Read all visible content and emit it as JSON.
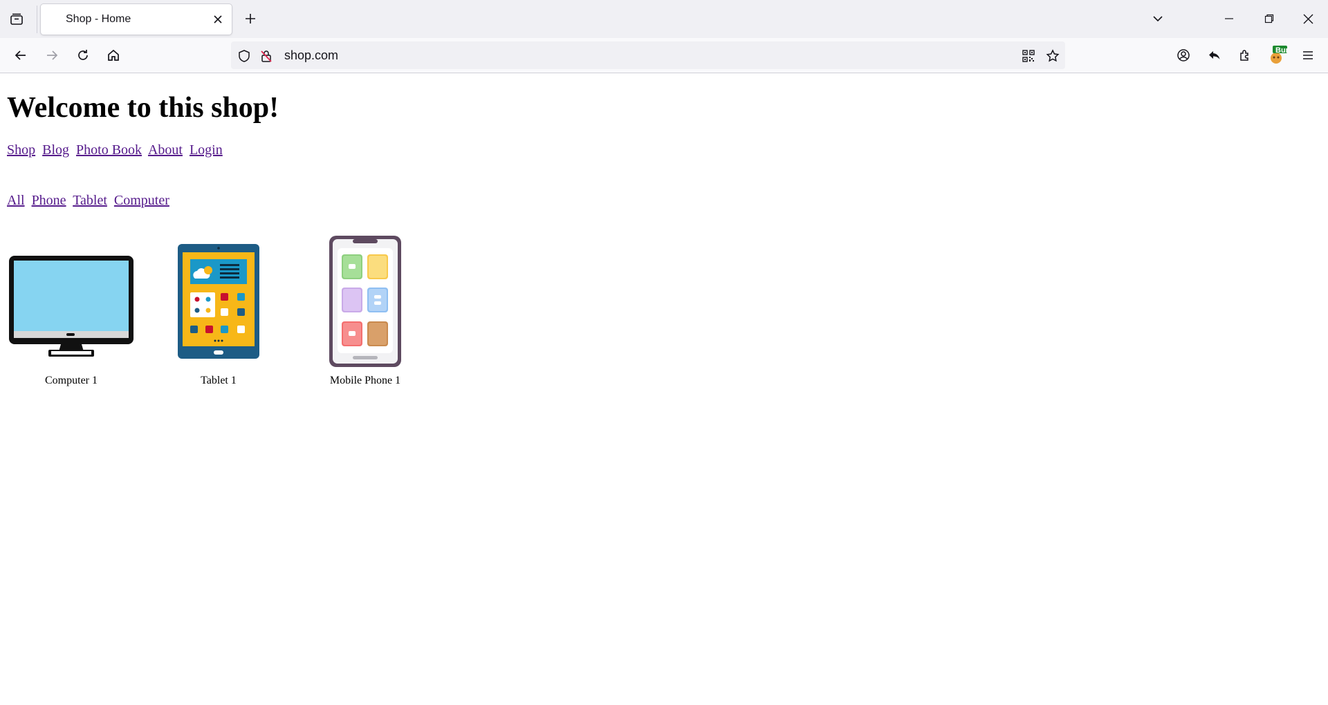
{
  "browser": {
    "tab_title": "Shop - Home",
    "url": "shop.com",
    "extension_badge": "Bur"
  },
  "page": {
    "heading": "Welcome to this shop!",
    "main_nav": [
      "Shop",
      "Blog",
      "Photo Book",
      "About",
      "Login"
    ],
    "category_nav": [
      "All",
      "Phone",
      "Tablet",
      "Computer"
    ],
    "products": [
      {
        "name": "Computer 1",
        "icon": "computer-icon"
      },
      {
        "name": "Tablet 1",
        "icon": "tablet-icon"
      },
      {
        "name": "Mobile Phone 1",
        "icon": "phone-icon"
      }
    ]
  }
}
